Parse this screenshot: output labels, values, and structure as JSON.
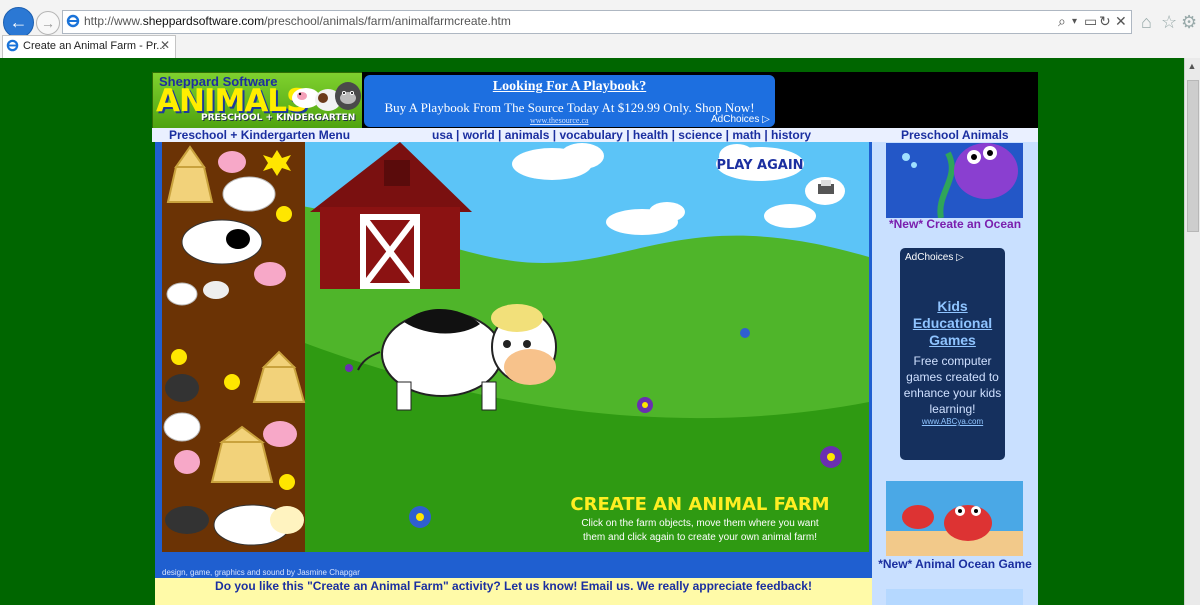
{
  "browser": {
    "url_prefix": "http://www.",
    "url_domain": "sheppardsoftware.com",
    "url_path": "/preschool/animals/farm/animalfarmcreate.htm",
    "tab_title": "Create an Animal Farm - Pr...",
    "tab_close": "✕"
  },
  "logo": {
    "top": "Sheppard Software",
    "main": "ANIMALS",
    "sub": "PRESCHOOL + KINDERGARTEN"
  },
  "banner_ad": {
    "title": "Looking For A Playbook?",
    "line": "Buy A Playbook From The Source Today At $129.99 Only. Shop Now!",
    "url": "www.thesource.ca",
    "choices": "AdChoices ▷"
  },
  "menu": {
    "left": "Preschool + Kindergarten Menu",
    "links": [
      "usa",
      "world",
      "animals",
      "vocabulary",
      "health",
      "science",
      "math",
      "history"
    ],
    "right": "Preschool Animals"
  },
  "game": {
    "play_again": "PLAY AGAIN",
    "title": "CREATE AN ANIMAL FARM",
    "instr1": "Click on the farm objects, move them where you want",
    "instr2": "them and click again to create your own animal farm!",
    "credit": "design, game, graphics and sound by Jasmine Chapgar"
  },
  "feedback": "Do you like this \"Create an Animal Farm\" activity? Let us know! Email us. We really appreciate feedback!",
  "sidebar": {
    "ocean_caption": "*New* Create an Ocean",
    "crab_caption": "*New* Animal Ocean Game"
  },
  "side_ad": {
    "choices": "AdChoices ▷",
    "title_1": "Kids",
    "title_2": "Educational",
    "title_3": "Games",
    "body": "Free computer games created to enhance your kids learning!",
    "url": "www.ABCya.com"
  }
}
